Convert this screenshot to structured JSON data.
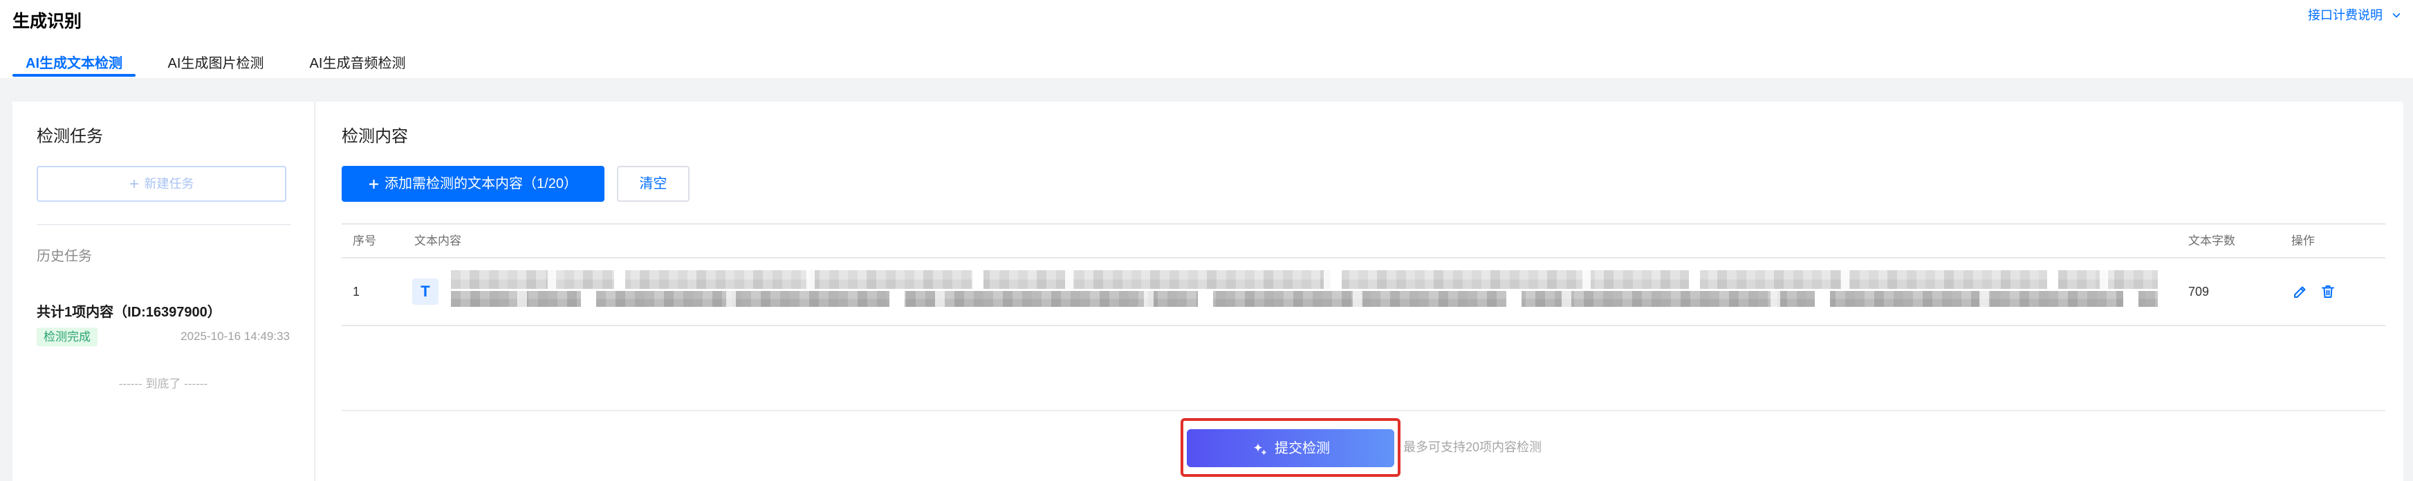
{
  "header": {
    "title": "生成识别",
    "pricing_link": "接口计费说明",
    "pricing_icon": "chevron-down-icon"
  },
  "tabs": [
    {
      "label": "AI生成文本检测",
      "active": true
    },
    {
      "label": "AI生成图片检测",
      "active": false
    },
    {
      "label": "AI生成音频检测",
      "active": false
    }
  ],
  "task_panel": {
    "title": "检测任务",
    "new_task": {
      "label": "新建任务",
      "icon": "plus-icon"
    },
    "history_title": "历史任务",
    "history": [
      {
        "summary": "共计1项内容（ID:16397900）",
        "status": "检测完成",
        "time": "2025-10-16 14:49:33"
      }
    ],
    "end_of_list": "------ 到底了 ------"
  },
  "content_panel": {
    "title": "检测内容",
    "add_button": {
      "label": "添加需检测的文本内容（1/20）",
      "icon": "plus-icon"
    },
    "clear_button": {
      "label": "清空"
    },
    "table": {
      "columns": [
        "序号",
        "文本内容",
        "文本字数",
        "操作"
      ],
      "rows": [
        {
          "index": "1",
          "type_glyph": "T",
          "char_count": "709",
          "actions": [
            "edit-icon",
            "delete-icon"
          ]
        }
      ]
    },
    "submit_button": {
      "label": "提交检测",
      "icon": "sparkle-icon",
      "highlighted": true
    },
    "submit_hint": "最多可支持20项内容检测"
  },
  "colors": {
    "primary": "#006eff",
    "page_background": "#f2f3f5",
    "success_text": "#2ba471",
    "success_background": "#e3f9e9",
    "submit_gradient_start": "#5551f2",
    "submit_gradient_end": "#6294f8",
    "highlight_border": "#e0302b"
  }
}
